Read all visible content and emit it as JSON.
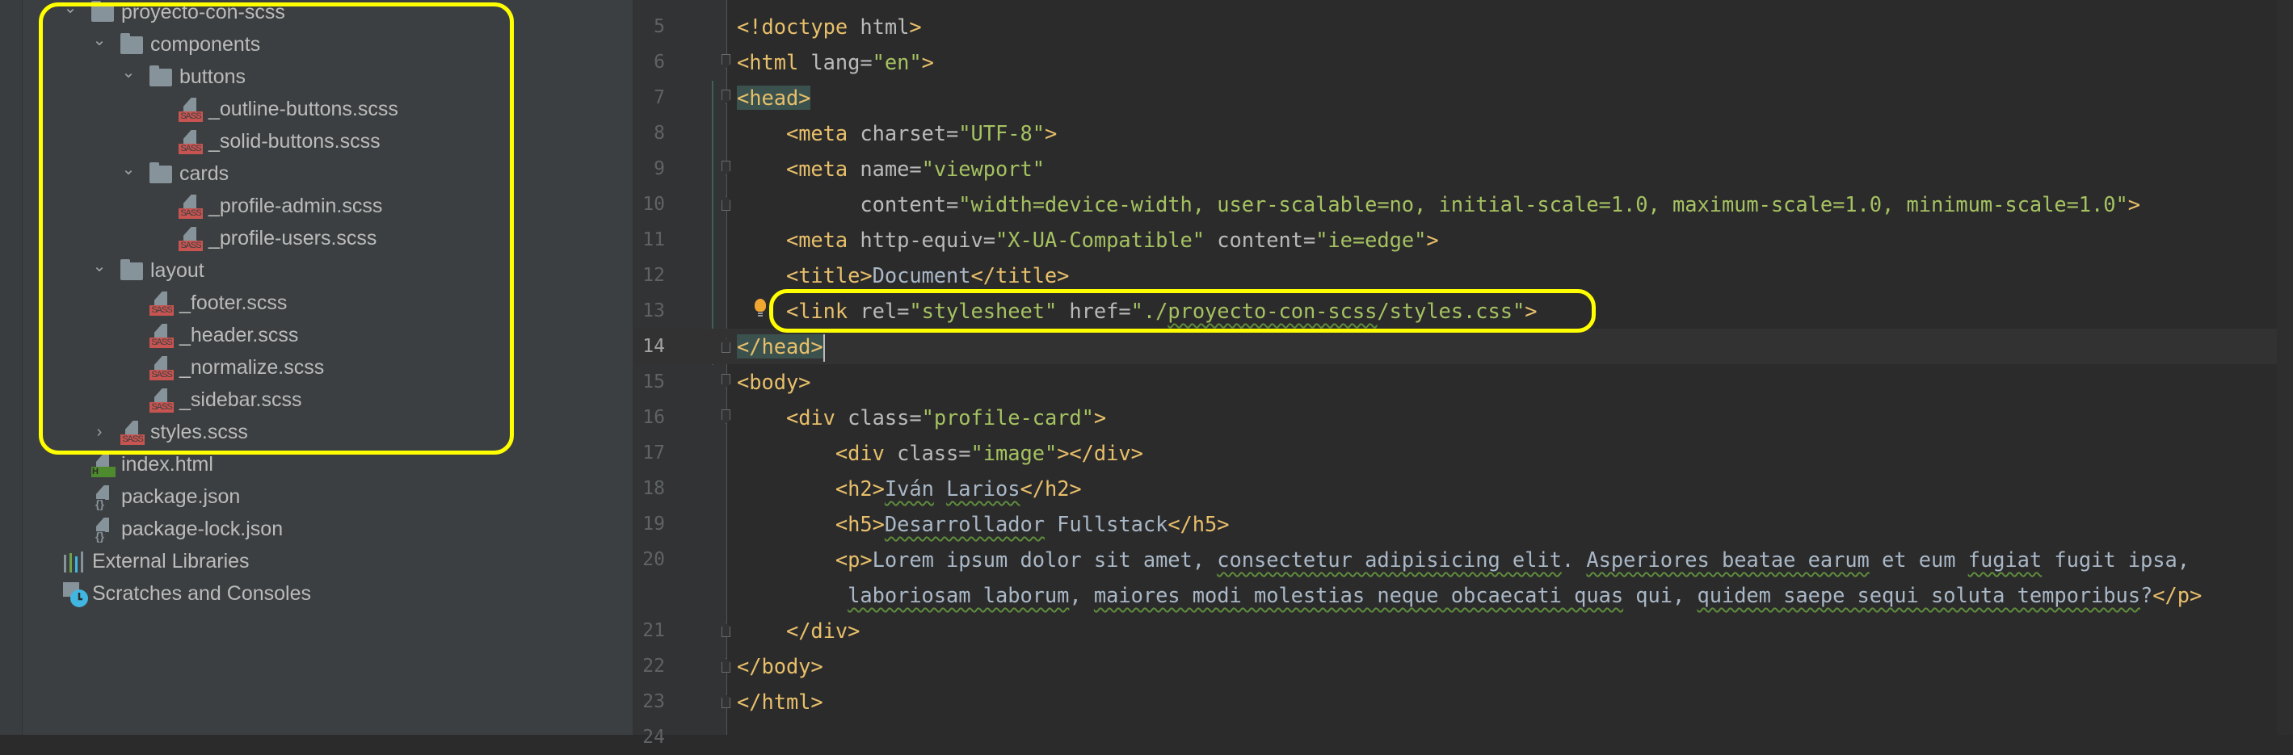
{
  "project_tree": {
    "items": [
      {
        "label": "proyecto-con-scss",
        "level": 0,
        "kind": "folder",
        "chevron": "expanded"
      },
      {
        "label": "components",
        "level": 1,
        "kind": "folder",
        "chevron": "expanded"
      },
      {
        "label": "buttons",
        "level": 2,
        "kind": "folder",
        "chevron": "expanded"
      },
      {
        "label": "_outline-buttons.scss",
        "level": 3,
        "kind": "sass"
      },
      {
        "label": "_solid-buttons.scss",
        "level": 3,
        "kind": "sass"
      },
      {
        "label": "cards",
        "level": 2,
        "kind": "folder",
        "chevron": "expanded"
      },
      {
        "label": "_profile-admin.scss",
        "level": 3,
        "kind": "sass"
      },
      {
        "label": "_profile-users.scss",
        "level": 3,
        "kind": "sass"
      },
      {
        "label": "layout",
        "level": 1,
        "kind": "folder",
        "chevron": "expanded"
      },
      {
        "label": "_footer.scss",
        "level": 2,
        "kind": "sass"
      },
      {
        "label": "_header.scss",
        "level": 2,
        "kind": "sass"
      },
      {
        "label": "_normalize.scss",
        "level": 2,
        "kind": "sass"
      },
      {
        "label": "_sidebar.scss",
        "level": 2,
        "kind": "sass"
      },
      {
        "label": "styles.scss",
        "level": 1,
        "kind": "sass",
        "chevron": "collapsed"
      },
      {
        "label": "index.html",
        "level": 0,
        "kind": "html"
      },
      {
        "label": "package.json",
        "level": 0,
        "kind": "json"
      },
      {
        "label": "package-lock.json",
        "level": 0,
        "kind": "json"
      },
      {
        "label": "External Libraries",
        "level": -1,
        "kind": "libraries"
      },
      {
        "label": "Scratches and Consoles",
        "level": -1,
        "kind": "scratches"
      }
    ],
    "badges": {
      "sass": "SASS",
      "html": "H",
      "json": "{}"
    }
  },
  "editor": {
    "current_line": "14",
    "lines": [
      {
        "n": "5",
        "fold": "",
        "tokens": [
          {
            "c": "tag",
            "t": "<!doctype"
          },
          {
            "c": "plain",
            "t": " html"
          },
          {
            "c": "tag",
            "t": ">"
          }
        ]
      },
      {
        "n": "6",
        "fold": "open",
        "tokens": [
          {
            "c": "tag",
            "t": "<html"
          },
          {
            "c": "attr",
            "t": " lang"
          },
          {
            "c": "eq",
            "t": "="
          },
          {
            "c": "val",
            "t": "\"en\""
          },
          {
            "c": "tag",
            "t": ">"
          }
        ]
      },
      {
        "n": "7",
        "fold": "open",
        "tokens": [
          {
            "c": "tag",
            "t": "<head>",
            "hl": true
          }
        ]
      },
      {
        "n": "8",
        "fold": "",
        "tokens": [
          {
            "c": "plain",
            "t": "    "
          },
          {
            "c": "tag",
            "t": "<meta"
          },
          {
            "c": "attr",
            "t": " charset"
          },
          {
            "c": "eq",
            "t": "="
          },
          {
            "c": "val",
            "t": "\"UTF-8\""
          },
          {
            "c": "tag",
            "t": ">"
          }
        ]
      },
      {
        "n": "9",
        "fold": "open",
        "tokens": [
          {
            "c": "plain",
            "t": "    "
          },
          {
            "c": "tag",
            "t": "<meta"
          },
          {
            "c": "attr",
            "t": " name"
          },
          {
            "c": "eq",
            "t": "="
          },
          {
            "c": "val",
            "t": "\"viewport\""
          }
        ]
      },
      {
        "n": "10",
        "fold": "close",
        "tokens": [
          {
            "c": "plain",
            "t": "          "
          },
          {
            "c": "attr",
            "t": "content"
          },
          {
            "c": "eq",
            "t": "="
          },
          {
            "c": "val",
            "t": "\"width=device-width, user-scalable=no, initial-scale=1.0, maximum-scale=1.0, minimum-scale=1.0\""
          },
          {
            "c": "tag",
            "t": ">"
          }
        ]
      },
      {
        "n": "11",
        "fold": "",
        "tokens": [
          {
            "c": "plain",
            "t": "    "
          },
          {
            "c": "tag",
            "t": "<meta"
          },
          {
            "c": "attr",
            "t": " http-equiv"
          },
          {
            "c": "eq",
            "t": "="
          },
          {
            "c": "val",
            "t": "\"X-UA-Compatible\""
          },
          {
            "c": "attr",
            "t": " content"
          },
          {
            "c": "eq",
            "t": "="
          },
          {
            "c": "val",
            "t": "\"ie=edge\""
          },
          {
            "c": "tag",
            "t": ">"
          }
        ]
      },
      {
        "n": "12",
        "fold": "",
        "tokens": [
          {
            "c": "plain",
            "t": "    "
          },
          {
            "c": "tag",
            "t": "<title>"
          },
          {
            "c": "text",
            "t": "Document"
          },
          {
            "c": "tag",
            "t": "</title>"
          }
        ]
      },
      {
        "n": "13",
        "fold": "",
        "tokens": [
          {
            "c": "plain",
            "t": "    "
          },
          {
            "c": "tag",
            "t": "<link"
          },
          {
            "c": "attr",
            "t": " rel"
          },
          {
            "c": "eq",
            "t": "="
          },
          {
            "c": "val",
            "t": "\"stylesheet\""
          },
          {
            "c": "attr",
            "t": " href"
          },
          {
            "c": "eq",
            "t": "="
          },
          {
            "c": "val",
            "t": "\"./"
          },
          {
            "c": "val",
            "t": "proyecto-con-scss",
            "sq": true
          },
          {
            "c": "val",
            "t": "/styles.css\""
          },
          {
            "c": "tag",
            "t": ">"
          }
        ]
      },
      {
        "n": "14",
        "fold": "close",
        "tokens": [
          {
            "c": "tag",
            "t": "</head>",
            "hl": true
          }
        ],
        "caret": true
      },
      {
        "n": "15",
        "fold": "open",
        "tokens": [
          {
            "c": "tag",
            "t": "<body>"
          }
        ]
      },
      {
        "n": "16",
        "fold": "open",
        "tokens": [
          {
            "c": "plain",
            "t": "    "
          },
          {
            "c": "tag",
            "t": "<div"
          },
          {
            "c": "attr",
            "t": " class"
          },
          {
            "c": "eq",
            "t": "="
          },
          {
            "c": "val",
            "t": "\"profile-card\""
          },
          {
            "c": "tag",
            "t": ">"
          }
        ]
      },
      {
        "n": "17",
        "fold": "",
        "tokens": [
          {
            "c": "plain",
            "t": "        "
          },
          {
            "c": "tag",
            "t": "<div"
          },
          {
            "c": "attr",
            "t": " class"
          },
          {
            "c": "eq",
            "t": "="
          },
          {
            "c": "val",
            "t": "\"image\""
          },
          {
            "c": "tag",
            "t": "></div>"
          }
        ]
      },
      {
        "n": "18",
        "fold": "",
        "tokens": [
          {
            "c": "plain",
            "t": "        "
          },
          {
            "c": "tag",
            "t": "<h2>"
          },
          {
            "c": "text",
            "t": "Iván",
            "sq": true
          },
          {
            "c": "text",
            "t": " "
          },
          {
            "c": "text",
            "t": "Larios",
            "sq": true
          },
          {
            "c": "tag",
            "t": "</h2>"
          }
        ]
      },
      {
        "n": "19",
        "fold": "",
        "tokens": [
          {
            "c": "plain",
            "t": "        "
          },
          {
            "c": "tag",
            "t": "<h5>"
          },
          {
            "c": "text",
            "t": "Desarrollador",
            "sq": true
          },
          {
            "c": "text",
            "t": " Fullstack"
          },
          {
            "c": "tag",
            "t": "</h5>"
          }
        ]
      },
      {
        "n": "20",
        "fold": "",
        "tokens": [
          {
            "c": "plain",
            "t": "        "
          },
          {
            "c": "tag",
            "t": "<p>"
          },
          {
            "c": "text",
            "t": "Lorem ipsum dolor sit amet, "
          },
          {
            "c": "text",
            "t": "consectetur adipisicing elit",
            "sq": true
          },
          {
            "c": "text",
            "t": ". "
          },
          {
            "c": "text",
            "t": "Asperiores beatae earum",
            "sq": true
          },
          {
            "c": "text",
            "t": " et eum "
          },
          {
            "c": "text",
            "t": "fugiat",
            "sq": true
          },
          {
            "c": "text",
            "t": " fugit ipsa,"
          }
        ]
      },
      {
        "n": "",
        "fold": "",
        "tokens": [
          {
            "c": "plain",
            "t": "         "
          },
          {
            "c": "text",
            "t": "laboriosam laborum",
            "sq": true
          },
          {
            "c": "text",
            "t": ", "
          },
          {
            "c": "text",
            "t": "maiores modi molestias neque obcaecati quas",
            "sq": true
          },
          {
            "c": "text",
            "t": " qui, "
          },
          {
            "c": "text",
            "t": "quidem saepe sequi soluta temporibus",
            "sq": true
          },
          {
            "c": "text",
            "t": "?"
          },
          {
            "c": "tag",
            "t": "</p>"
          }
        ]
      },
      {
        "n": "21",
        "fold": "close",
        "tokens": [
          {
            "c": "plain",
            "t": "    "
          },
          {
            "c": "tag",
            "t": "</div>"
          }
        ]
      },
      {
        "n": "22",
        "fold": "close",
        "tokens": [
          {
            "c": "tag",
            "t": "</body>"
          }
        ]
      },
      {
        "n": "23",
        "fold": "close",
        "tokens": [
          {
            "c": "tag",
            "t": "</html>"
          }
        ]
      },
      {
        "n": "24",
        "fold": "",
        "tokens": []
      }
    ]
  },
  "colors": {
    "highlight_box": "#ffff00",
    "tag": "#e8bf6a",
    "attr": "#bababa",
    "value": "#a5c261",
    "text": "#a9b7c6",
    "sass_badge": "#c75450"
  },
  "icons": {
    "folder": "folder-icon",
    "sass": "sass-file-icon",
    "html": "html-file-icon",
    "json": "json-file-icon",
    "libraries": "external-libraries-icon",
    "scratches": "scratches-icon",
    "bulb": "intention-bulb-icon"
  }
}
